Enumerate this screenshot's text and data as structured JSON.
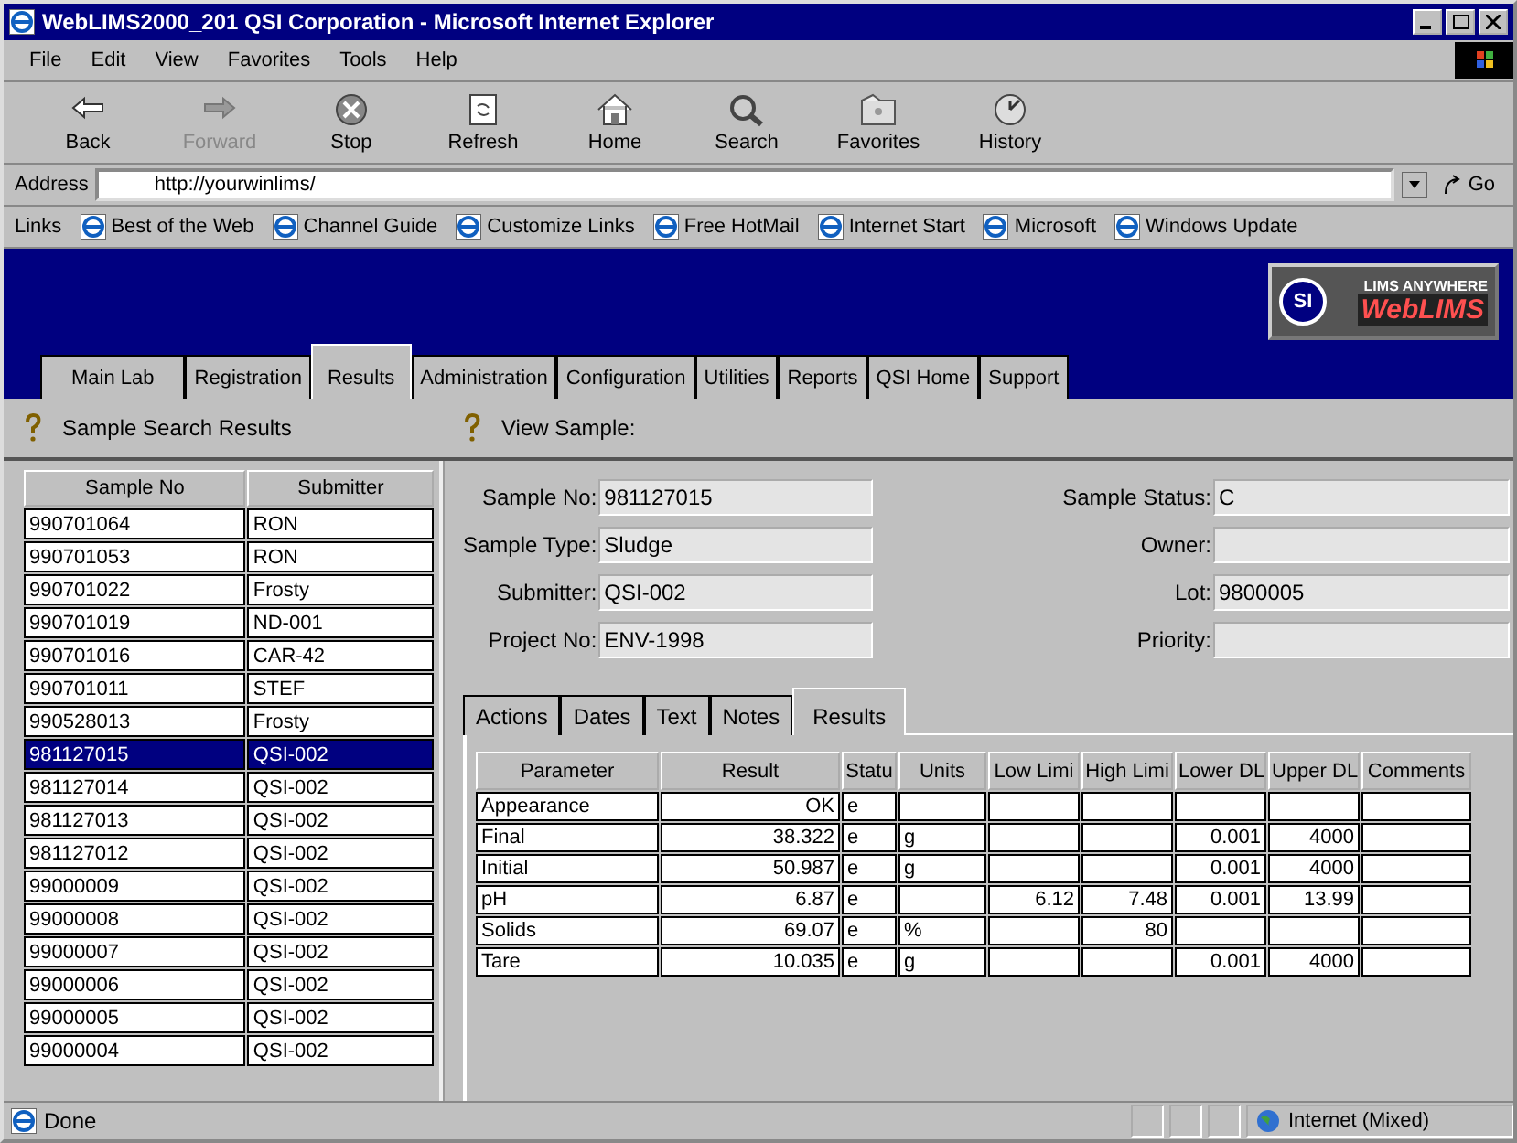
{
  "window": {
    "title": "WebLIMS2000_201 QSI Corporation - Microsoft Internet Explorer"
  },
  "menu": [
    "File",
    "Edit",
    "View",
    "Favorites",
    "Tools",
    "Help"
  ],
  "toolbar": [
    {
      "label": "Back",
      "kind": "back",
      "disabled": false
    },
    {
      "label": "Forward",
      "kind": "forward",
      "disabled": true
    },
    {
      "label": "Stop",
      "kind": "stop",
      "disabled": false
    },
    {
      "label": "Refresh",
      "kind": "refresh",
      "disabled": false
    },
    {
      "label": "Home",
      "kind": "home",
      "disabled": false
    },
    {
      "label": "Search",
      "kind": "search",
      "disabled": false
    },
    {
      "label": "Favorites",
      "kind": "favorites",
      "disabled": false
    },
    {
      "label": "History",
      "kind": "history",
      "disabled": false
    }
  ],
  "address": {
    "label": "Address",
    "value": "http://yourwinlims/",
    "go": "Go"
  },
  "links": {
    "label": "Links",
    "items": [
      "Best of the Web",
      "Channel Guide",
      "Customize Links",
      "Free HotMail",
      "Internet Start",
      "Microsoft",
      "Windows Update"
    ]
  },
  "app_tabs": [
    {
      "label": "Main Lab",
      "selected": false
    },
    {
      "label": "Registration",
      "selected": false
    },
    {
      "label": "Results",
      "selected": true
    },
    {
      "label": "Administration",
      "selected": false
    },
    {
      "label": "Configuration",
      "selected": false
    },
    {
      "label": "Utilities",
      "selected": false
    },
    {
      "label": "Reports",
      "selected": false
    },
    {
      "label": "QSI Home",
      "selected": false
    },
    {
      "label": "Support",
      "selected": false
    }
  ],
  "logo": {
    "badge": "SI",
    "tagline": "LIMS ANYWHERE",
    "name": "WebLIMS"
  },
  "left_panel": {
    "title": "Sample Search Results",
    "columns": [
      "Sample No",
      "Submitter"
    ],
    "rows": [
      {
        "sample_no": "990701064",
        "submitter": "RON",
        "selected": false
      },
      {
        "sample_no": "990701053",
        "submitter": "RON",
        "selected": false
      },
      {
        "sample_no": "990701022",
        "submitter": "Frosty",
        "selected": false
      },
      {
        "sample_no": "990701019",
        "submitter": "ND-001",
        "selected": false
      },
      {
        "sample_no": "990701016",
        "submitter": "CAR-42",
        "selected": false
      },
      {
        "sample_no": "990701011",
        "submitter": "STEF",
        "selected": false
      },
      {
        "sample_no": "990528013",
        "submitter": "Frosty",
        "selected": false
      },
      {
        "sample_no": "981127015",
        "submitter": "QSI-002",
        "selected": true
      },
      {
        "sample_no": "981127014",
        "submitter": "QSI-002",
        "selected": false
      },
      {
        "sample_no": "981127013",
        "submitter": "QSI-002",
        "selected": false
      },
      {
        "sample_no": "981127012",
        "submitter": "QSI-002",
        "selected": false
      },
      {
        "sample_no": "99000009",
        "submitter": "QSI-002",
        "selected": false
      },
      {
        "sample_no": "99000008",
        "submitter": "QSI-002",
        "selected": false
      },
      {
        "sample_no": "99000007",
        "submitter": "QSI-002",
        "selected": false
      },
      {
        "sample_no": "99000006",
        "submitter": "QSI-002",
        "selected": false
      },
      {
        "sample_no": "99000005",
        "submitter": "QSI-002",
        "selected": false
      },
      {
        "sample_no": "99000004",
        "submitter": "QSI-002",
        "selected": false
      }
    ]
  },
  "right_panel": {
    "title": "View Sample:",
    "fields_left": [
      {
        "label": "Sample No:",
        "value": "981127015"
      },
      {
        "label": "Sample Type:",
        "value": "Sludge"
      },
      {
        "label": "Submitter:",
        "value": "QSI-002"
      },
      {
        "label": "Project No:",
        "value": "ENV-1998"
      }
    ],
    "fields_right": [
      {
        "label": "Sample Status:",
        "value": "C"
      },
      {
        "label": "Owner:"
      },
      {
        "label": "Lot:",
        "value": "9800005"
      },
      {
        "label": "Priority:"
      }
    ],
    "tabs": [
      {
        "label": "Actions",
        "selected": false
      },
      {
        "label": "Dates",
        "selected": false
      },
      {
        "label": "Text",
        "selected": false
      },
      {
        "label": "Notes",
        "selected": false
      },
      {
        "label": "Results",
        "selected": true
      }
    ],
    "grid": {
      "columns": [
        {
          "label": "Parameter",
          "kind": "text"
        },
        {
          "label": "Result",
          "kind": "number"
        },
        {
          "label": "Statu",
          "kind": "text"
        },
        {
          "label": "Units",
          "kind": "text"
        },
        {
          "label": "Low Limi",
          "kind": "number"
        },
        {
          "label": "High Limi",
          "kind": "number"
        },
        {
          "label": "Lower DL",
          "kind": "number"
        },
        {
          "label": "Upper DL",
          "kind": "number"
        },
        {
          "label": "Comments",
          "kind": "text"
        }
      ],
      "rows": [
        [
          "Appearance",
          "OK",
          "e",
          "",
          "",
          "",
          "",
          "",
          ""
        ],
        [
          "Final",
          "38.322",
          "e",
          "g",
          "",
          "",
          "0.001",
          "4000",
          ""
        ],
        [
          "Initial",
          "50.987",
          "e",
          "g",
          "",
          "",
          "0.001",
          "4000",
          ""
        ],
        [
          "pH",
          "6.87",
          "e",
          "",
          "6.12",
          "7.48",
          "0.001",
          "13.99",
          ""
        ],
        [
          "Solids",
          "69.07",
          "e",
          "%",
          "",
          "80",
          "",
          "",
          ""
        ],
        [
          "Tare",
          "10.035",
          "e",
          "g",
          "",
          "",
          "0.001",
          "4000",
          ""
        ]
      ]
    }
  },
  "status_bar": {
    "text": "Done",
    "zone": "Internet (Mixed)"
  }
}
